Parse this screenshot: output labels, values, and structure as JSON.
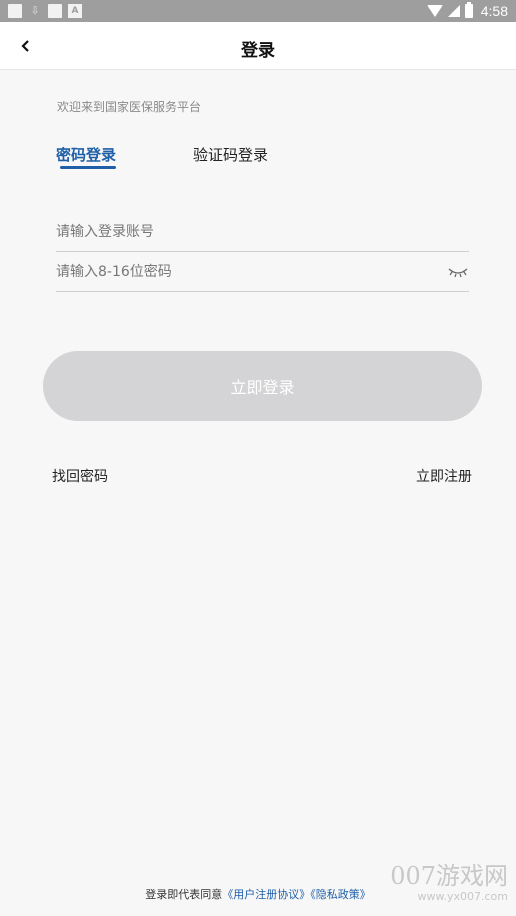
{
  "status_bar": {
    "time": "4:58"
  },
  "header": {
    "title": "登录"
  },
  "welcome_text": "欢迎来到国家医保服务平台",
  "tabs": [
    {
      "label": "密码登录",
      "active": true
    },
    {
      "label": "验证码登录",
      "active": false
    }
  ],
  "form": {
    "account_placeholder": "请输入登录账号",
    "account_value": "",
    "password_placeholder": "请输入8-16位密码",
    "password_value": ""
  },
  "login_button": {
    "label": "立即登录"
  },
  "links": {
    "forgot_password": "找回密码",
    "register": "立即注册"
  },
  "agreement": {
    "prefix": "登录即代表同意",
    "user_agreement": "《用户注册协议》",
    "privacy_policy": "《隐私政策》"
  },
  "watermark": {
    "main": "007游戏网",
    "sub": "www.yx007.com"
  },
  "colors": {
    "accent": "#1f5fa8",
    "button_disabled": "#d4d4d6",
    "background": "#f7f7f7",
    "status_bar": "#9e9e9e"
  },
  "icons": {
    "back": "chevron-left-icon",
    "password_visibility": "eye-closed-icon"
  }
}
